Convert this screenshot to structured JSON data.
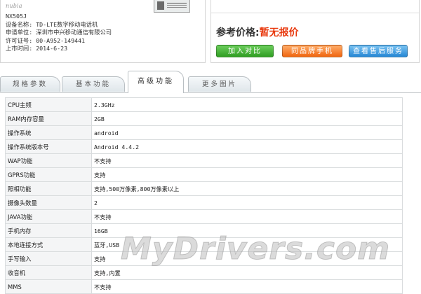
{
  "brand": {
    "logo_text": "nubia"
  },
  "device": {
    "model": "NX505J",
    "rows": [
      {
        "label": "设备名称:",
        "value": "TD-LTE数字移动电话机"
      },
      {
        "label": "申请单位:",
        "value": "深圳市中兴移动通信有限公司"
      },
      {
        "label": "许可证号:",
        "value": "00-A952-149441"
      },
      {
        "label": "上市时间:",
        "value": "2014-6-23"
      }
    ]
  },
  "price": {
    "label": "参考价格:",
    "value": "暂无报价"
  },
  "actions": {
    "compare": "加入对比",
    "same_brand": "同品牌手机",
    "stores": "查看售后服务"
  },
  "tabs": [
    {
      "label": "规格参数"
    },
    {
      "label": "基本功能"
    },
    {
      "label": "高级功能"
    },
    {
      "label": "更多图片"
    }
  ],
  "specs": [
    {
      "k": "CPU主频",
      "v": "2.3GHz"
    },
    {
      "k": "RAM内存容量",
      "v": "2GB"
    },
    {
      "k": "操作系统",
      "v": "android"
    },
    {
      "k": "操作系统版本号",
      "v": "Android 4.4.2"
    },
    {
      "k": "WAP功能",
      "v": "不支持"
    },
    {
      "k": "GPRS功能",
      "v": "支持"
    },
    {
      "k": "照相功能",
      "v": "支持,500万像素,800万像素以上"
    },
    {
      "k": "摄像头数量",
      "v": "2"
    },
    {
      "k": "JAVA功能",
      "v": "不支持"
    },
    {
      "k": "手机内存",
      "v": "16GB"
    },
    {
      "k": "本地连接方式",
      "v": "蓝牙,USB"
    },
    {
      "k": "手写输入",
      "v": "支持"
    },
    {
      "k": "收音机",
      "v": "支持,内置"
    },
    {
      "k": "MMS",
      "v": "不支持"
    }
  ],
  "watermark": "MyDrivers.com",
  "colors": {
    "price_value": "#e8380d",
    "btn_green": "#2f9d22",
    "btn_orange": "#f0650f",
    "btn_blue": "#2586d4"
  }
}
